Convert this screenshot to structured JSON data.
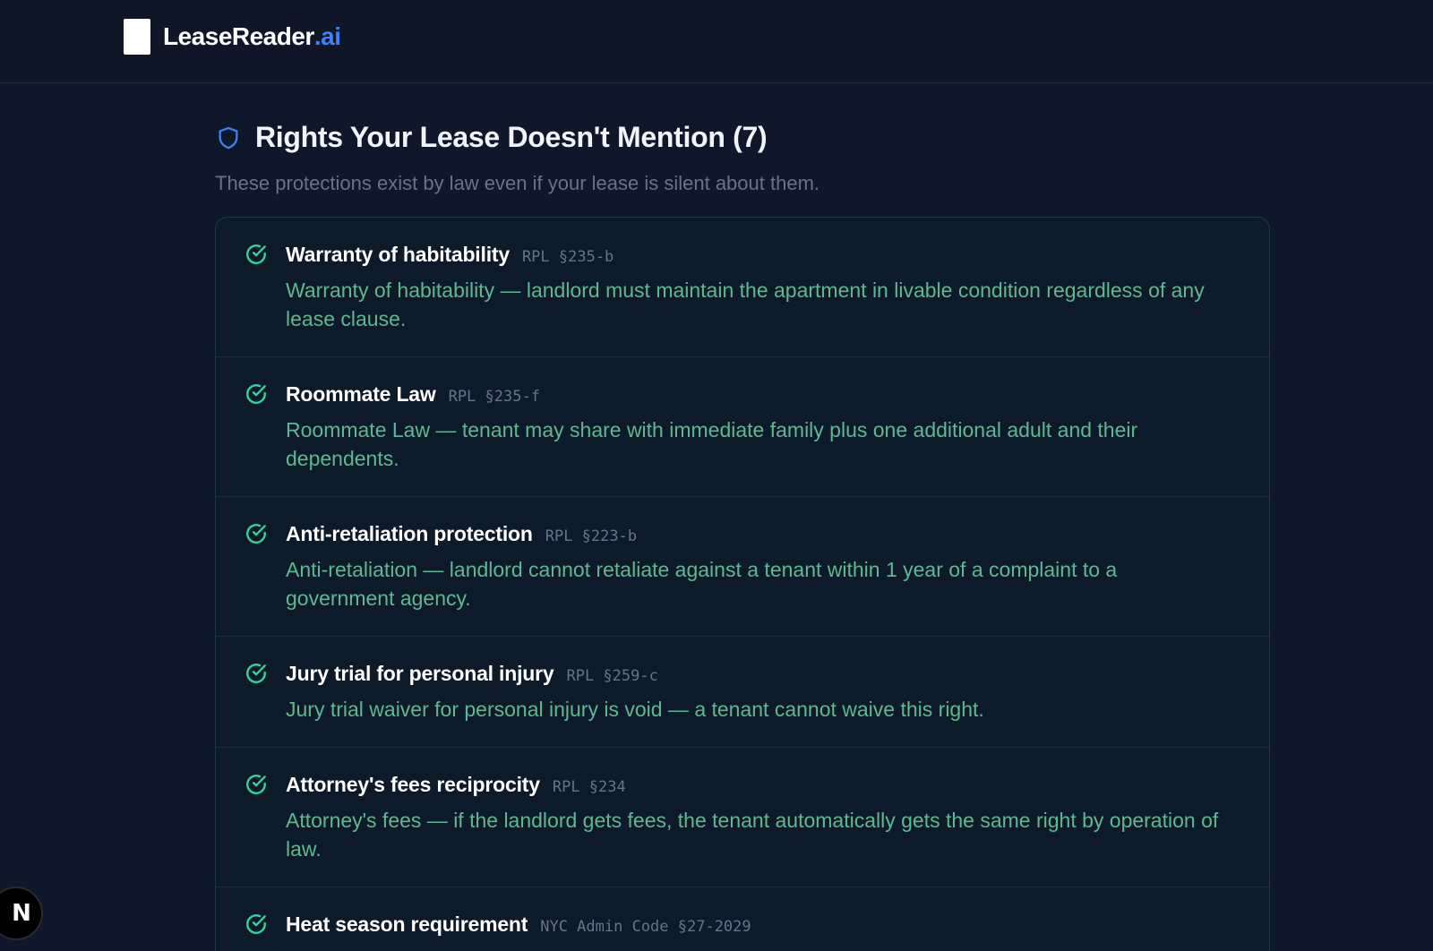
{
  "header": {
    "brand_name": "LeaseReader",
    "brand_tld": ".ai"
  },
  "section": {
    "title": "Rights Your Lease Doesn't Mention (7)",
    "subtitle": "These protections exist by law even if your lease is silent about them."
  },
  "rights": [
    {
      "title": "Warranty of habitability",
      "citation": "RPL §235-b",
      "description": "Warranty of habitability — landlord must maintain the apartment in livable condition regardless of any lease clause."
    },
    {
      "title": "Roommate Law",
      "citation": "RPL §235-f",
      "description": "Roommate Law — tenant may share with immediate family plus one additional adult and their dependents."
    },
    {
      "title": "Anti-retaliation protection",
      "citation": "RPL §223-b",
      "description": "Anti-retaliation — landlord cannot retaliate against a tenant within 1 year of a complaint to a government agency."
    },
    {
      "title": "Jury trial for personal injury",
      "citation": "RPL §259-c",
      "description": "Jury trial waiver for personal injury is void — a tenant cannot waive this right."
    },
    {
      "title": "Attorney's fees reciprocity",
      "citation": "RPL §234",
      "description": "Attorney's fees — if the landlord gets fees, the tenant automatically gets the same right by operation of law."
    },
    {
      "title": "Heat season requirement",
      "citation": "NYC Admin Code §27-2029",
      "description": ""
    }
  ],
  "dev_badge": {
    "label": "N"
  },
  "colors": {
    "background": "#0f172a",
    "accent_blue": "#3b82f6",
    "check_green": "#34d399",
    "description_green": "#5fb88f"
  }
}
